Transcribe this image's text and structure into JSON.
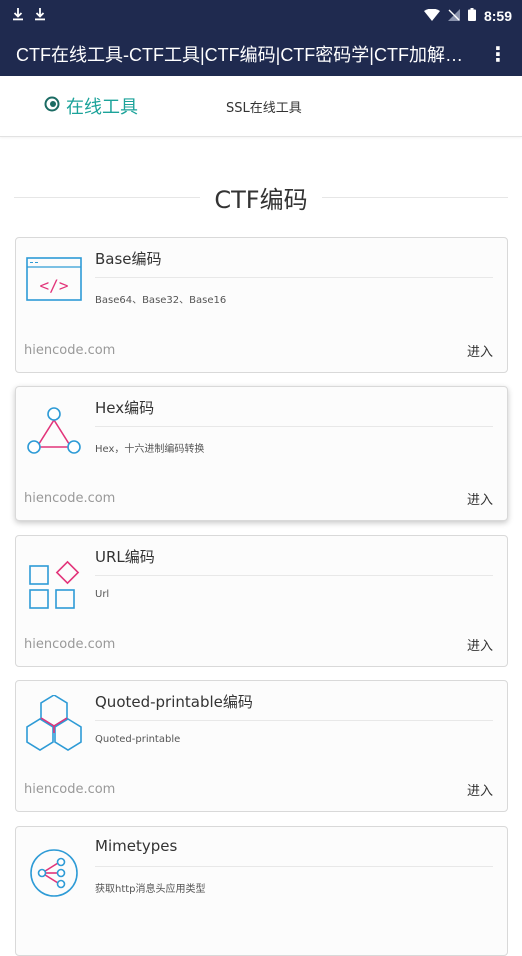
{
  "status_bar": {
    "time": "8:59"
  },
  "app_bar": {
    "title": "CTF在线工具-CTF工具|CTF编码|CTF密码学|CTF加解…",
    "menu_glyph": "⋮"
  },
  "tabs": [
    {
      "label": "在线工具"
    },
    {
      "label": "SSL在线工具"
    }
  ],
  "section": {
    "title": "CTF编码"
  },
  "cards": [
    {
      "title": "Base编码",
      "desc": "Base64、Base32、Base16",
      "domain": "hiencode.com",
      "enter": "进入",
      "icon": "code-window-icon"
    },
    {
      "title": "Hex编码",
      "desc": "Hex，十六进制编码转换",
      "domain": "hiencode.com",
      "enter": "进入",
      "icon": "triangle-nodes-icon"
    },
    {
      "title": "URL编码",
      "desc": "Url",
      "domain": "hiencode.com",
      "enter": "进入",
      "icon": "squares-diamond-icon"
    },
    {
      "title": "Quoted-printable编码",
      "desc": "Quoted-printable",
      "domain": "hiencode.com",
      "enter": "进入",
      "icon": "hexagons-icon"
    },
    {
      "title": "Mimetypes",
      "desc": "获取http消息头应用类型",
      "icon": "share-nodes-icon"
    }
  ],
  "colors": {
    "primary": "#1f2a4f",
    "accent": "#1ca39a",
    "icon_blue": "#2e9bd6",
    "icon_pink": "#e2347a"
  }
}
